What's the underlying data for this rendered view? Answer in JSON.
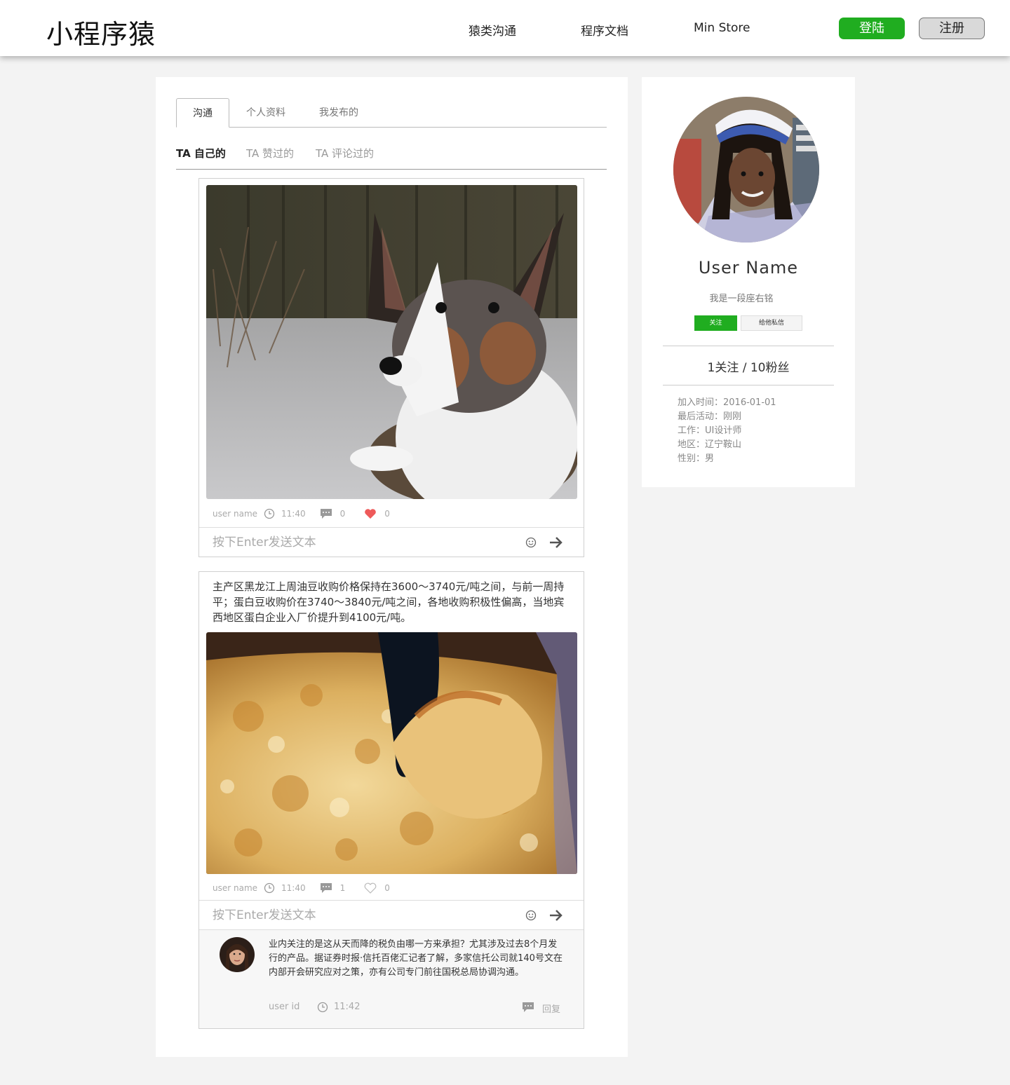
{
  "header": {
    "logo": "小程序猿",
    "nav": [
      "猿类沟通",
      "程序文档",
      "Min Store"
    ],
    "login_label": "登陆",
    "register_label": "注册",
    "accent_color": "#20ad20"
  },
  "tabs": [
    "沟通",
    "个人资料",
    "我发布的"
  ],
  "active_tab": "沟通",
  "subtabs": [
    "TA 自己的",
    "TA 赞过的",
    "TA 评论过的"
  ],
  "posts": [
    {
      "image": "corgi-dog-in-snow-photo",
      "meta": {
        "user": "user name",
        "time": "11:40",
        "comments": "0",
        "likes": "0",
        "liked": true
      },
      "input_placeholder": "按下Enter发送文本"
    },
    {
      "text": "主产区黑龙江上周油豆收购价格保持在3600～3740元/吨之间，与前一周持平；蛋白豆收购价在3740～3840元/吨之间，各地收购积极性偏高，当地宾西地区蛋白企业入厂价提升到4100元/吨。",
      "image": "baked-pasta-photo",
      "meta": {
        "user": "user name",
        "time": "11:40",
        "comments": "1",
        "likes": "0",
        "liked": false
      },
      "input_placeholder": "按下Enter发送文本",
      "reply": {
        "text": "业内关注的是这从天而降的税负由哪一方来承担？尤其涉及过去8个月发行的产品。据证券时报·信托百佬汇记者了解，多家信托公司就140号文在内部开会研究应对之策，亦有公司专门前往国税总局协调沟通。",
        "user": "user id",
        "time": "11:42",
        "reply_label": "回复"
      }
    }
  ],
  "profile": {
    "name": "User Name",
    "motto": "我是一段座右铭",
    "follow_label": "关注",
    "message_label": "给他私信",
    "stats": "1关注 / 10粉丝",
    "info": [
      "加入时间：2016-01-01",
      "最后活动：刚刚",
      "工作：UI设计师",
      "地区：辽宁鞍山",
      "性别：男"
    ]
  }
}
